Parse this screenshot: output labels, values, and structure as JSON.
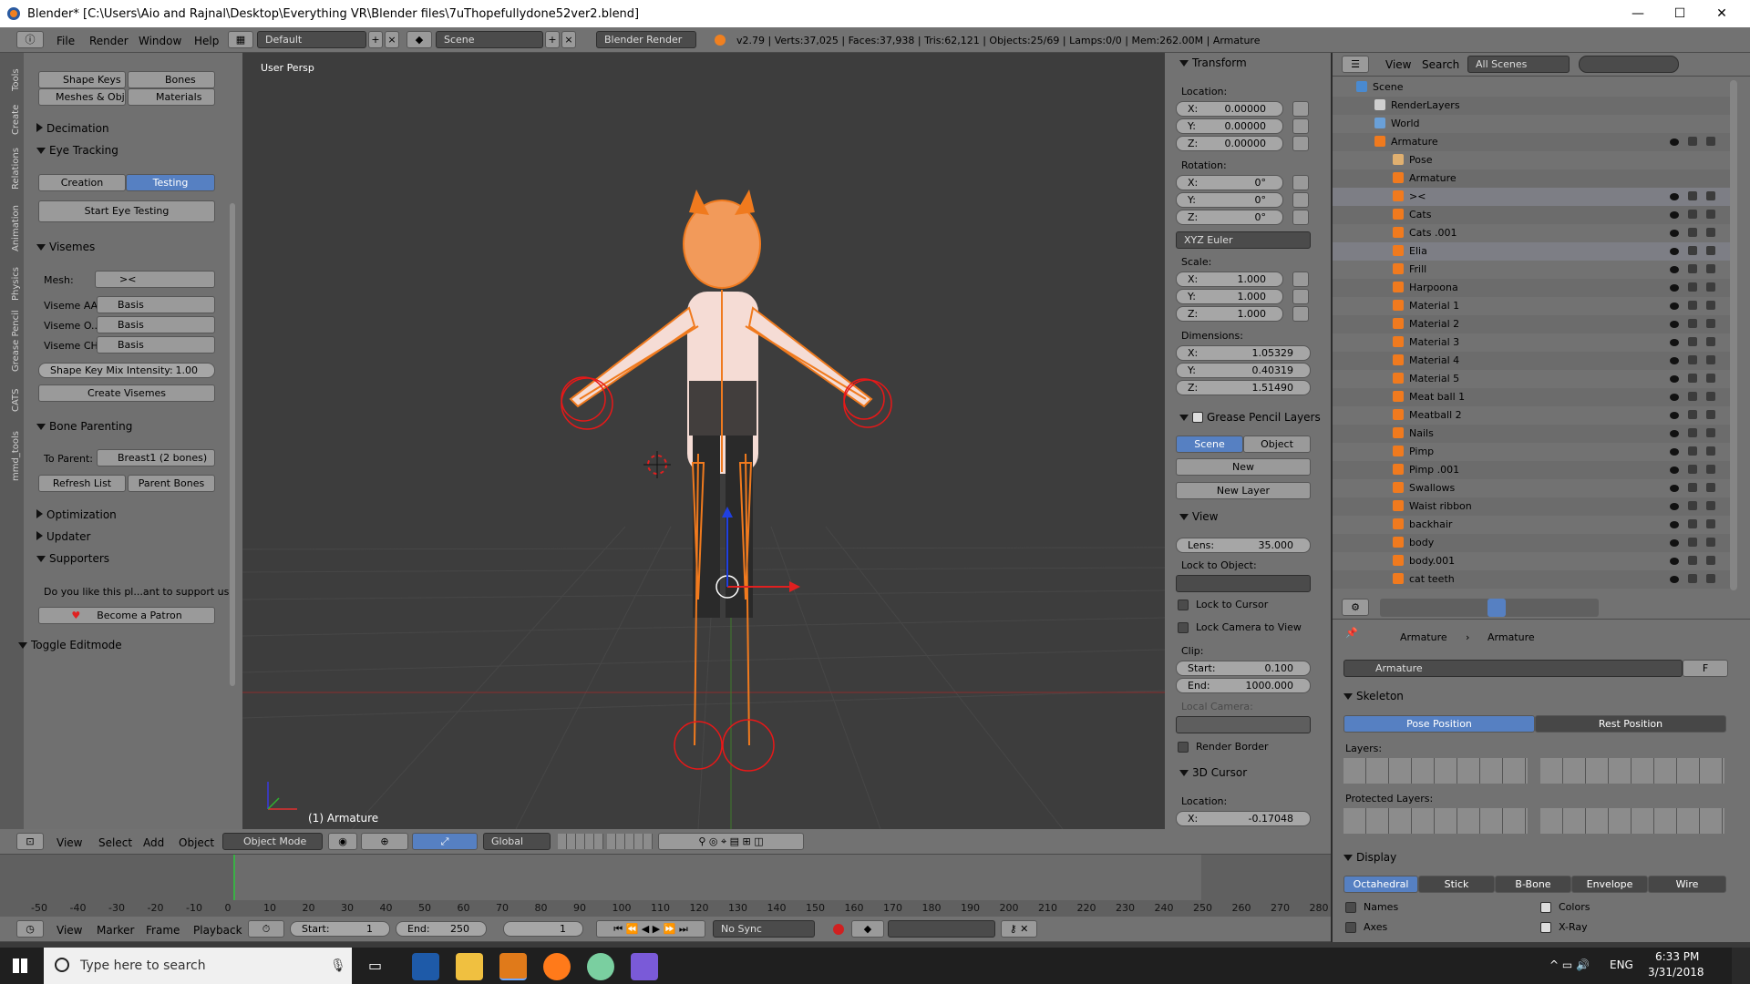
{
  "window": {
    "title": "Blender* [C:\\Users\\Aio and Rajnal\\Desktop\\Everything VR\\Blender files\\7uThopefullydone52ver2.blend]"
  },
  "info_header": {
    "menus": [
      "File",
      "Render",
      "Window",
      "Help"
    ],
    "layout": "Default",
    "scene": "Scene",
    "engine": "Blender Render",
    "stats": "v2.79 | Verts:37,025 | Faces:37,938 | Tris:62,121 | Objects:25/69 | Lamps:0/0 | Mem:262.00M | Armature"
  },
  "toolshelf": {
    "tabs": [
      "Tools",
      "Create",
      "Relations",
      "Animation",
      "Physics",
      "Grease Pencil",
      "CATS",
      "mmd_tools"
    ],
    "shape_keys": "Shape Keys",
    "bones": "Bones",
    "meshes": "Meshes & Obj...",
    "materials": "Materials",
    "decimation": "Decimation",
    "eye_tracking": "Eye Tracking",
    "creation": "Creation",
    "testing": "Testing",
    "start_eye_testing": "Start Eye Testing",
    "visemes": "Visemes",
    "mesh_label": "Mesh:",
    "mesh_value": "><",
    "viseme_aa": "Viseme AA",
    "viseme_o": "Viseme O...",
    "viseme_ch": "Viseme CH",
    "basis": "Basis",
    "shape_key_mix": "Shape Key Mix Intensity:",
    "shape_key_mix_value": "1.00",
    "create_visemes": "Create Visemes",
    "bone_parenting": "Bone Parenting",
    "to_parent": "To Parent:",
    "to_parent_value": "Breast1 (2 bones)",
    "refresh_list": "Refresh List",
    "parent_bones": "Parent Bones",
    "optimization": "Optimization",
    "updater": "Updater",
    "supporters": "Supporters",
    "support_text": "Do you like this pl...ant to support us?",
    "become_patron": "Become a Patron",
    "toggle_editmode": "Toggle Editmode"
  },
  "viewport": {
    "view_name": "User Persp",
    "object_label": "(1) Armature"
  },
  "properties_n": {
    "transform": "Transform",
    "location": "Location:",
    "loc": [
      {
        "axis": "X:",
        "value": "0.00000"
      },
      {
        "axis": "Y:",
        "value": "0.00000"
      },
      {
        "axis": "Z:",
        "value": "0.00000"
      }
    ],
    "rotation": "Rotation:",
    "rot": [
      {
        "axis": "X:",
        "value": "0°"
      },
      {
        "axis": "Y:",
        "value": "0°"
      },
      {
        "axis": "Z:",
        "value": "0°"
      }
    ],
    "rot_mode": "XYZ Euler",
    "scale": "Scale:",
    "scl": [
      {
        "axis": "X:",
        "value": "1.000"
      },
      {
        "axis": "Y:",
        "value": "1.000"
      },
      {
        "axis": "Z:",
        "value": "1.000"
      }
    ],
    "dimensions": "Dimensions:",
    "dim": [
      {
        "axis": "X:",
        "value": "1.05329"
      },
      {
        "axis": "Y:",
        "value": "0.40319"
      },
      {
        "axis": "Z:",
        "value": "1.51490"
      }
    ],
    "grease_pencil": "Grease Pencil Layers",
    "gp_scene": "Scene",
    "gp_object": "Object",
    "gp_new": "New",
    "gp_new_layer": "New Layer",
    "view": "View",
    "lens": "Lens:",
    "lens_value": "35.000",
    "lock_to_object": "Lock to Object:",
    "lock_to_cursor": "Lock to Cursor",
    "lock_camera": "Lock Camera to View",
    "clip": "Clip:",
    "clip_start": "Start:",
    "clip_start_value": "0.100",
    "clip_end": "End:",
    "clip_end_value": "1000.000",
    "local_camera": "Local Camera:",
    "render_border": "Render Border",
    "cursor": "3D Cursor",
    "cursor_location": "Location:",
    "cursor_x": "X:",
    "cursor_x_value": "-0.17048"
  },
  "outliner": {
    "view": "View",
    "search": "Search",
    "filter": "All Scenes",
    "items": [
      {
        "name": "Scene",
        "indent": 0
      },
      {
        "name": "RenderLayers",
        "indent": 1
      },
      {
        "name": "World",
        "indent": 1
      },
      {
        "name": "Armature",
        "indent": 1
      },
      {
        "name": "Pose",
        "indent": 2
      },
      {
        "name": "Armature",
        "indent": 2
      },
      {
        "name": "><",
        "indent": 2
      },
      {
        "name": "Cats",
        "indent": 2
      },
      {
        "name": "Cats .001",
        "indent": 2
      },
      {
        "name": "Elia",
        "indent": 2
      },
      {
        "name": "Frill",
        "indent": 2
      },
      {
        "name": "Harpoona",
        "indent": 2
      },
      {
        "name": "Material 1",
        "indent": 2
      },
      {
        "name": "Material 2",
        "indent": 2
      },
      {
        "name": "Material 3",
        "indent": 2
      },
      {
        "name": "Material 4",
        "indent": 2
      },
      {
        "name": "Material 5",
        "indent": 2
      },
      {
        "name": "Meat ball 1",
        "indent": 2
      },
      {
        "name": "Meatball 2",
        "indent": 2
      },
      {
        "name": "Nails",
        "indent": 2
      },
      {
        "name": "Pimp",
        "indent": 2
      },
      {
        "name": "Pimp .001",
        "indent": 2
      },
      {
        "name": "Swallows",
        "indent": 2
      },
      {
        "name": "Waist ribbon",
        "indent": 2
      },
      {
        "name": "backhair",
        "indent": 2
      },
      {
        "name": "body",
        "indent": 2
      },
      {
        "name": "body.001",
        "indent": 2
      },
      {
        "name": "cat teeth",
        "indent": 2
      }
    ]
  },
  "properties": {
    "breadcrumb_1": "Armature",
    "breadcrumb_2": "Armature",
    "datablock": "Armature",
    "fake_user": "F",
    "skeleton": "Skeleton",
    "pose_position": "Pose Position",
    "rest_position": "Rest Position",
    "layers": "Layers:",
    "protected_layers": "Protected Layers:",
    "display": "Display",
    "display_modes": [
      "Octahedral",
      "Stick",
      "B-Bone",
      "Envelope",
      "Wire"
    ],
    "names": "Names",
    "colors": "Colors",
    "axes": "Axes",
    "xray": "X-Ray"
  },
  "view3d_header": {
    "menus": [
      "View",
      "Select",
      "Add",
      "Object"
    ],
    "mode": "Object Mode",
    "orientation": "Global"
  },
  "timeline": {
    "ticks": [
      "-50",
      "-40",
      "-30",
      "-20",
      "-10",
      "0",
      "10",
      "20",
      "30",
      "40",
      "50",
      "60",
      "70",
      "80",
      "90",
      "100",
      "110",
      "120",
      "130",
      "140",
      "150",
      "160",
      "170",
      "180",
      "190",
      "200",
      "210",
      "220",
      "230",
      "240",
      "250",
      "260",
      "270",
      "280"
    ],
    "menus": [
      "View",
      "Marker",
      "Frame",
      "Playback"
    ],
    "start_label": "Start:",
    "start": "1",
    "end_label": "End:",
    "end": "250",
    "current": "1",
    "sync": "No Sync"
  },
  "taskbar": {
    "search_placeholder": "Type here to search",
    "lang": "ENG",
    "time": "6:33 PM",
    "date": "3/31/2018"
  },
  "colors": {
    "accent": "#5680c2",
    "armature": "#f07a1e",
    "selection_red": "#e81818"
  }
}
